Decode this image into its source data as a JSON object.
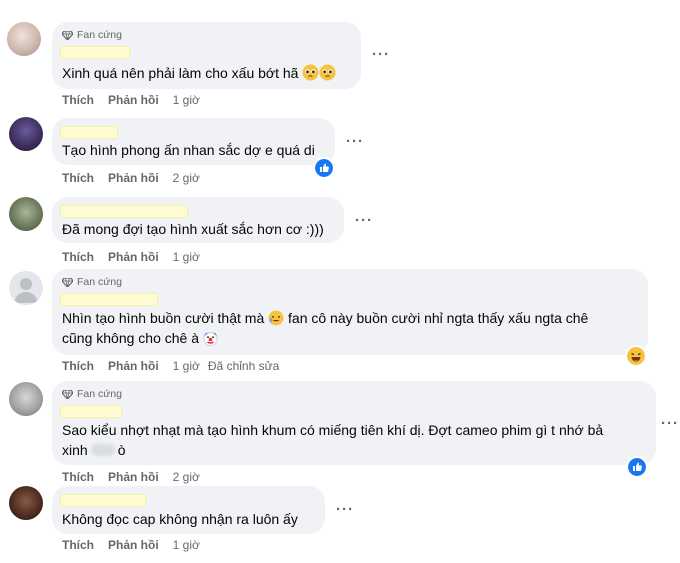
{
  "comments": [
    {
      "badge": "Fan cứng",
      "text": "Xinh quá nên phải làm cho xấu bớt hã",
      "like": "Thích",
      "reply": "Phản hồi",
      "time": "1 giờ"
    },
    {
      "text": "Tạo hình phong ấn nhan sắc dợ e quá di",
      "like": "Thích",
      "reply": "Phản hồi",
      "time": "2 giờ",
      "reaction": "like"
    },
    {
      "text": "Đã mong đợi tạo hình xuất sắc hơn cơ :)))",
      "like": "Thích",
      "reply": "Phản hồi",
      "time": "1 giờ"
    },
    {
      "badge": "Fan cứng",
      "text_line1": "Nhìn tạo hình buồn cười thật mà",
      "text_line1b": "fan cô này buồn cười nhỉ ngta thấy xấu ngta chê",
      "text_line2": "cũng không cho chê à",
      "like": "Thích",
      "reply": "Phản hồi",
      "time": "1 giờ",
      "edited": "Đã chỉnh sửa",
      "reaction": "haha"
    },
    {
      "badge": "Fan cứng",
      "text_line1": "Sao kiểu nhợt nhạt mà tạo hình khum có miếng tiên khí dị. Đợt cameo phim gì t nhớ bả",
      "text_line2a": "xinh",
      "text_line2b": "ò",
      "like": "Thích",
      "reply": "Phản hồi",
      "time": "2 giờ",
      "reaction": "like"
    },
    {
      "text": "Không đọc cap không nhận ra luôn ấy",
      "like": "Thích",
      "reply": "Phản hồi",
      "time": "1 giờ"
    }
  ],
  "more_label": "···",
  "colors": {
    "bubble": "#f0f2f5",
    "muted": "#65676b",
    "like_blue": "#1877f2",
    "name_redaction": "#fffbd1"
  }
}
